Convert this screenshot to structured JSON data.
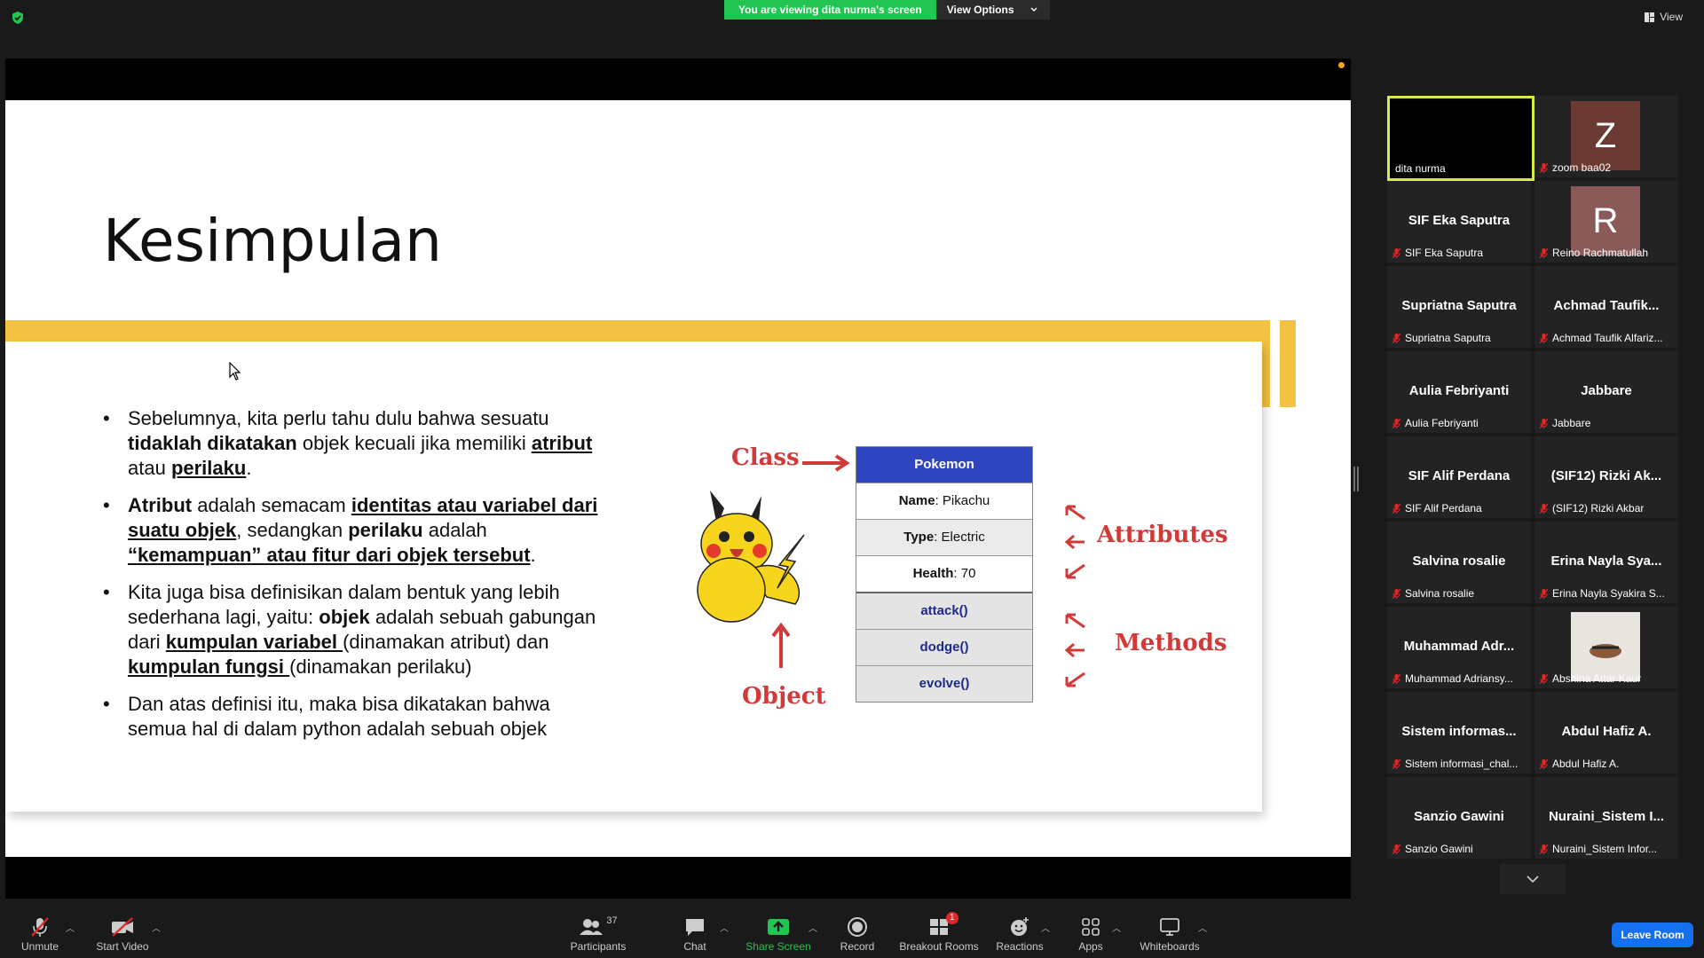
{
  "banner": {
    "viewing_text": "You are viewing dita nurma's screen",
    "view_options": "View Options",
    "view_label": "View"
  },
  "slide": {
    "title": "Kesimpulan",
    "bullets": [
      {
        "parts": [
          [
            "Sebelumnya, kita perlu tahu dulu bahwa sesuatu ",
            ""
          ],
          [
            "tidaklah dikatakan",
            "b"
          ],
          [
            " objek kecuali jika memiliki ",
            ""
          ],
          [
            "atribut",
            "bu"
          ],
          [
            " atau ",
            ""
          ],
          [
            "perilaku",
            "bu"
          ],
          [
            ".",
            ""
          ]
        ]
      },
      {
        "parts": [
          [
            "Atribut",
            "b"
          ],
          [
            " adalah semacam ",
            ""
          ],
          [
            "identitas atau variabel dari suatu objek",
            "bu"
          ],
          [
            ", sedangkan ",
            ""
          ],
          [
            "perilaku",
            "b"
          ],
          [
            " adalah ",
            ""
          ],
          [
            "“kemampuan” atau fitur dari objek tersebut",
            "bu"
          ],
          [
            ".",
            ""
          ]
        ]
      },
      {
        "parts": [
          [
            "Kita juga bisa definisikan dalam bentuk yang lebih sederhana lagi, yaitu: ",
            ""
          ],
          [
            "objek",
            "b"
          ],
          [
            " adalah sebuah gabungan dari ",
            ""
          ],
          [
            "kumpulan variabel ",
            "bu"
          ],
          [
            "(dinamakan atribut) dan ",
            ""
          ],
          [
            "kumpulan fungsi ",
            "bu"
          ],
          [
            "(dinamakan perilaku)",
            ""
          ]
        ]
      },
      {
        "parts": [
          [
            "Dan atas definisi itu, maka bisa dikatakan bahwa semua hal di dalam python adalah sebuah objek",
            ""
          ]
        ]
      }
    ],
    "diagram": {
      "class_label": "Class",
      "object_label": "Object",
      "attributes_label": "Attributes",
      "methods_label": "Methods",
      "table_header": "Pokemon",
      "attributes": [
        {
          "key": "Name",
          "value": ": Pikachu"
        },
        {
          "key": "Type",
          "value": ": Electric"
        },
        {
          "key": "Health",
          "value": ": 70"
        }
      ],
      "methods": [
        "attack()",
        "dodge()",
        "evolve()"
      ]
    }
  },
  "participants": [
    {
      "tile": "",
      "label": "dita nurma",
      "active": true,
      "muted": false
    },
    {
      "tile": "Z",
      "label": "zoom baa02",
      "avatar_color": "#6b3a33",
      "muted": true
    },
    {
      "tile": "SIF Eka Saputra",
      "label": "SIF Eka Saputra",
      "muted": true
    },
    {
      "tile": "R",
      "label": "Reino Rachmatullah",
      "avatar_color": "#8a5a59",
      "muted": true
    },
    {
      "tile": "Supriatna Saputra",
      "label": "Supriatna Saputra",
      "muted": true
    },
    {
      "tile": "Achmad  Taufik...",
      "label": "Achmad Taufik Alfariz...",
      "muted": true
    },
    {
      "tile": "Aulia Febriyanti",
      "label": "Aulia Febriyanti",
      "muted": true
    },
    {
      "tile": "Jabbare",
      "label": "Jabbare",
      "muted": true
    },
    {
      "tile": "SIF Alif Perdana",
      "label": "SIF Alif Perdana",
      "muted": true
    },
    {
      "tile": "(SIF12) Rizki Ak...",
      "label": "(SIF12) Rizki Akbar",
      "muted": true
    },
    {
      "tile": "Salvina rosalie",
      "label": "Salvina rosalie",
      "muted": true
    },
    {
      "tile": "Erina  Nayla  Sya...",
      "label": "Erina Nayla Syakira S...",
      "muted": true
    },
    {
      "tile": "Muhammad  Adr...",
      "label": "Muhammad Adriansy...",
      "muted": true
    },
    {
      "tile": "",
      "label": "Abshina Attar Kaur",
      "photo": true,
      "muted": true
    },
    {
      "tile": "Sistem  informas...",
      "label": "Sistem informasi_chal...",
      "muted": true
    },
    {
      "tile": "Abdul Hafiz A.",
      "label": "Abdul Hafiz A.",
      "muted": true
    },
    {
      "tile": "Sanzio Gawini",
      "label": "Sanzio Gawini",
      "muted": true
    },
    {
      "tile": "Nuraini_Sistem  I...",
      "label": "Nuraini_Sistem Infor...",
      "muted": true
    }
  ],
  "toolbar": {
    "unmute": "Unmute",
    "start_video": "Start Video",
    "participants": "Participants",
    "participant_count": "37",
    "chat": "Chat",
    "share_screen": "Share Screen",
    "record": "Record",
    "breakout_rooms": "Breakout Rooms",
    "breakout_badge": "1",
    "reactions": "Reactions",
    "apps": "Apps",
    "whiteboards": "Whiteboards",
    "leave": "Leave Room"
  },
  "colors": {
    "accent_green": "#23c552",
    "slide_yellow": "#f4c242",
    "leave_blue": "#1570ef",
    "active_border": "#d8e94a"
  }
}
